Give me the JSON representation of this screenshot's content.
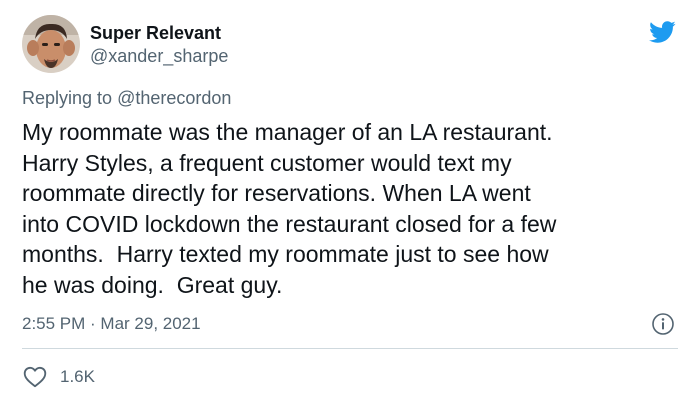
{
  "author": {
    "display_name": "Super Relevant",
    "handle": "@xander_sharpe",
    "avatar_icon": "profile-photo"
  },
  "reply": {
    "prefix": "Replying to ",
    "handle": "@therecordon"
  },
  "tweet": {
    "text": "My roommate was the manager of an LA restaurant.\nHarry Styles, a frequent customer would text my\nroommate directly for reservations. When LA went\ninto COVID lockdown the restaurant closed for a few\nmonths.  Harry texted my roommate just to see how\nhe was doing.  Great guy.",
    "timestamp": "2:55 PM · Mar 29, 2021"
  },
  "actions": {
    "likes": "1.6K"
  },
  "icons": {
    "brand": "twitter-bird-icon",
    "info": "info-icon",
    "like": "heart-icon"
  },
  "colors": {
    "brand": "#1d9bf0",
    "text_primary": "#0f1419",
    "text_secondary": "#536471",
    "divider": "#cfd9de"
  }
}
